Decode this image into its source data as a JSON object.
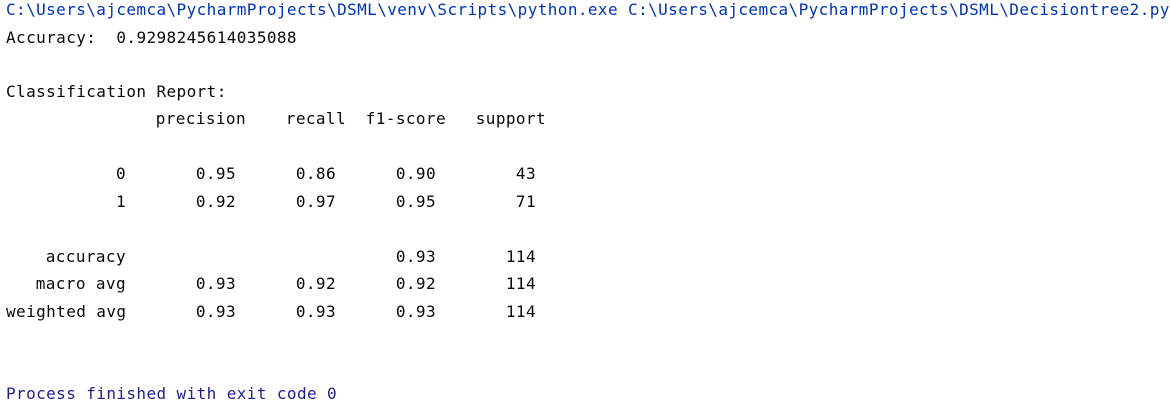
{
  "console": {
    "command": "C:\\Users\\ajcemca\\PycharmProjects\\DSML\\venv\\Scripts\\python.exe C:\\Users\\ajcemca\\PycharmProjects\\DSML\\Decisiontree2.py",
    "accuracy_label": "Accuracy:",
    "accuracy_value": "0.9298245614035088",
    "report_title": "Classification Report:",
    "headers": [
      "precision",
      "recall",
      "f1-score",
      "support"
    ],
    "rows": [
      {
        "label": "0",
        "precision": "0.95",
        "recall": "0.86",
        "f1": "0.90",
        "support": "43"
      },
      {
        "label": "1",
        "precision": "0.92",
        "recall": "0.97",
        "f1": "0.95",
        "support": "71"
      },
      {
        "label": "accuracy",
        "precision": "",
        "recall": "",
        "f1": "0.93",
        "support": "114"
      },
      {
        "label": "macro avg",
        "precision": "0.93",
        "recall": "0.92",
        "f1": "0.92",
        "support": "114"
      },
      {
        "label": "weighted avg",
        "precision": "0.93",
        "recall": "0.93",
        "f1": "0.93",
        "support": "114"
      }
    ],
    "exit_message": "Process finished with exit code 0",
    "colors": {
      "command": "#0033b3",
      "exit": "#1f1f8c",
      "text": "#080808",
      "background": "#ffffff"
    }
  }
}
